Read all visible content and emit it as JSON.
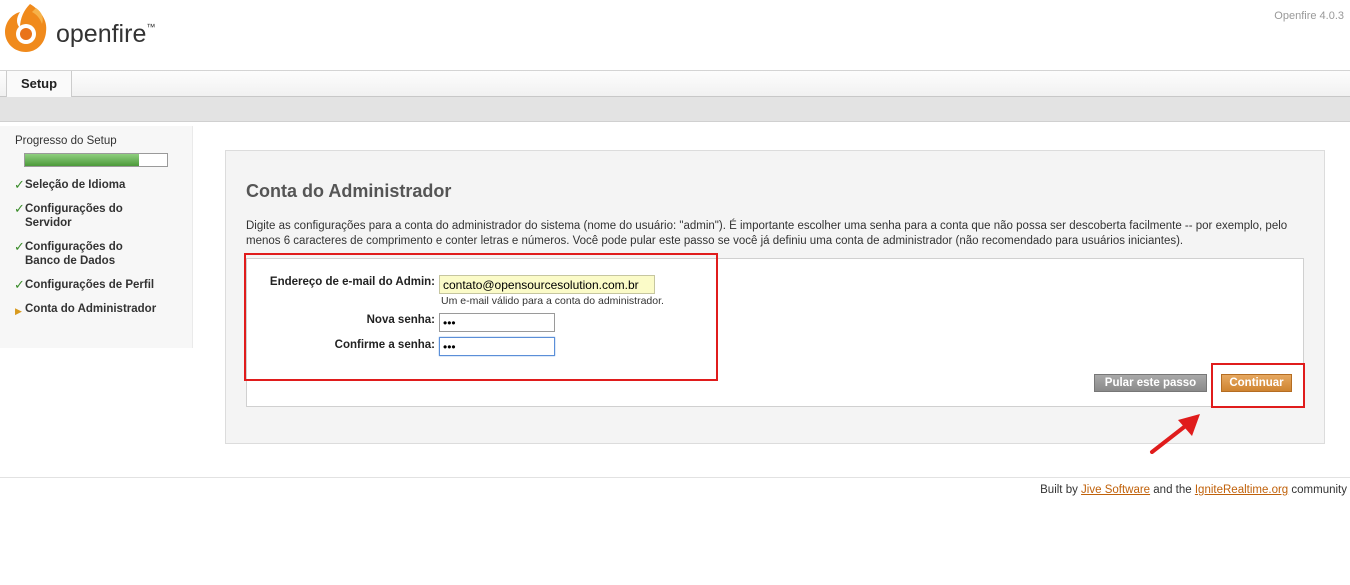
{
  "header": {
    "logo_text": "openfire",
    "logo_tm": "™",
    "version": "Openfire 4.0.3"
  },
  "tabs": [
    {
      "label": "Setup"
    }
  ],
  "sidebar": {
    "progress_label": "Progresso do Setup",
    "progress_fraction": 0.8,
    "steps": [
      {
        "label": "Seleção de Idioma",
        "status": "done"
      },
      {
        "label": "Configurações do Servidor",
        "status": "done"
      },
      {
        "label": "Configurações do Banco de Dados",
        "status": "done"
      },
      {
        "label": "Configurações de Perfil",
        "status": "done"
      },
      {
        "label": "Conta do Administrador",
        "status": "current"
      }
    ]
  },
  "main": {
    "title": "Conta do Administrador",
    "description": "Digite as configurações para a conta do administrador do sistema (nome do usuário: \"admin\"). É importante escolher uma senha para a conta que não possa ser descoberta facilmente -- por exemplo, pelo menos 6 caracteres de comprimento e conter letras e números. Você pode pular este passo se você já definiu uma conta de administrador (não recomendado para usuários iniciantes).",
    "form": {
      "email_label": "Endereço de e-mail do Admin:",
      "email_value": "contato@opensourcesolution.com.br",
      "email_hint": "Um e-mail válido para a conta do administrador.",
      "password_label": "Nova senha:",
      "password_value": "•••",
      "confirm_label": "Confirme a senha:",
      "confirm_value": "•••"
    },
    "buttons": {
      "skip": "Pular este passo",
      "continue": "Continuar"
    }
  },
  "footer": {
    "prefix": "Built by",
    "link1": "Jive Software",
    "middle": "and the",
    "link2": "IgniteRealtime.org",
    "suffix": "community"
  },
  "colors": {
    "accent_orange": "#d8842c",
    "annotation_red": "#e01c1c",
    "progress_green": "#4c9a3a"
  }
}
